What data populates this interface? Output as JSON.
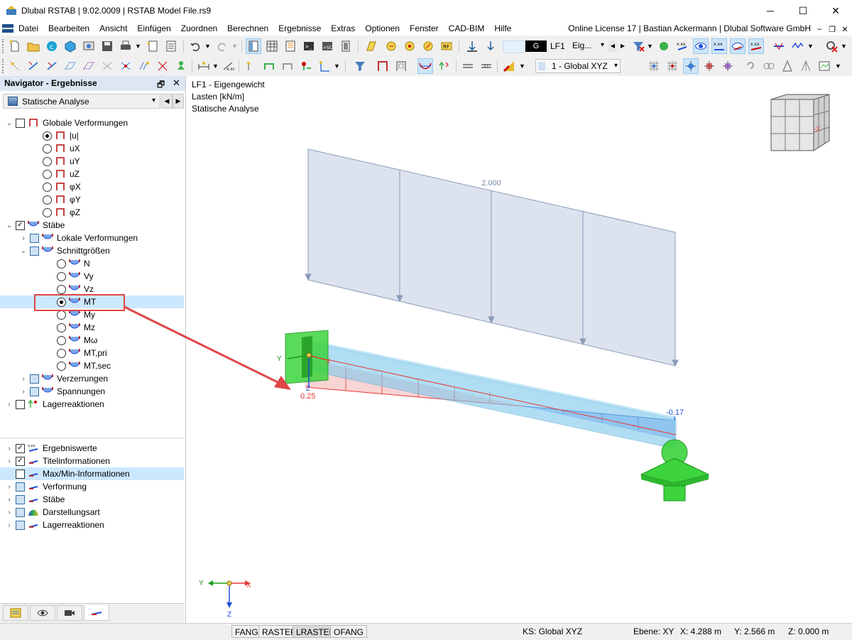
{
  "window": {
    "title": "Dlubal RSTAB | 9.02.0009 | RSTAB Model File.rs9",
    "controls": {
      "minimize": "─",
      "maximize": "☐",
      "close": "✕"
    }
  },
  "menubar": {
    "items": [
      "Datei",
      "Bearbeiten",
      "Ansicht",
      "Einfügen",
      "Zuordnen",
      "Berechnen",
      "Ergebnisse",
      "Extras",
      "Optionen",
      "Fenster",
      "CAD-BIM",
      "Hilfe"
    ],
    "license": "Online License 17 | Bastian Ackermann | Dlubal Software GmbH",
    "mdi_controls": {
      "minimize": "–",
      "restore": "❐",
      "close": "✕"
    }
  },
  "toolbar": {
    "load_case_type": "G",
    "load_case": "LF1",
    "load_case_name": "Eig...",
    "coordinate_system": "1 - Global XYZ"
  },
  "navigator": {
    "title": "Navigator - Ergebnisse",
    "dropdown": "Statische Analyse",
    "tree": {
      "globale_verformungen": "Globale Verformungen",
      "u_abs": "|u|",
      "ux": "uX",
      "uy": "uY",
      "uz": "uZ",
      "phix": "φX",
      "phiy": "φY",
      "phiz": "φZ",
      "staebe": "Stäbe",
      "lokale_verformungen": "Lokale Verformungen",
      "schnittgroessen": "Schnittgrößen",
      "n": "N",
      "vy": "Vy",
      "vz": "Vz",
      "mt": "MT",
      "my": "My",
      "mz": "Mz",
      "momega": "Mω",
      "mt_pri": "MT,pri",
      "mt_sec": "MT,sec",
      "verzerrungen": "Verzerrungen",
      "spannungen": "Spannungen",
      "lagerreaktionen": "Lagerreaktionen"
    },
    "display": {
      "ergebniswerte": "Ergebniswerte",
      "titelinformationen": "Titelinformationen",
      "maxmin": "Max/Min-Informationen",
      "verformung": "Verformung",
      "staebe": "Stäbe",
      "darstellungsart": "Darstellungsart",
      "lagerreaktionen": "Lagerreaktionen"
    }
  },
  "viewport": {
    "info_line1": "LF1 - Eigengewicht",
    "info_line2": "Lasten [kN/m]",
    "info_line3": "Statische Analyse",
    "load_value": "2.000",
    "result_start": "0.25",
    "result_end": "-0.17",
    "axis_x": "X",
    "axis_y": "Y",
    "axis_z": "Z",
    "viewcube_label": "-X",
    "colors": {
      "highlight_box": "#e04646",
      "load_fill": "#dde3ee",
      "member": "#7ec8ec",
      "support": "#3dd43d",
      "result_positive": "#e53935",
      "result_negative": "#1f4fd6"
    }
  },
  "statusbar": {
    "buttons": [
      "FANG",
      "RASTER",
      "LRASTER",
      "OFANG"
    ],
    "ks": "KS: Global XYZ",
    "ebene": "Ebene: XY",
    "x": "X: 4.288 m",
    "y": "Y: 2.566 m",
    "z": "Z: 0.000 m"
  }
}
